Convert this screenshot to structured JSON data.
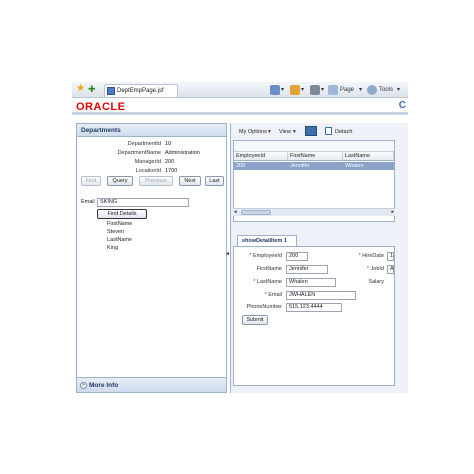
{
  "browser": {
    "tab_title": "DeptEmpPage.jsf",
    "page_menu": "Page",
    "tools_menu": "Tools"
  },
  "header": {
    "logo": "ORACLE"
  },
  "departments": {
    "title": "Departments",
    "fields": [
      {
        "label": "DepartmentId",
        "value": "10"
      },
      {
        "label": "DepartmentName",
        "value": "Administration"
      },
      {
        "label": "ManagerId",
        "value": "200"
      },
      {
        "label": "LocationId",
        "value": "1700"
      }
    ],
    "buttons": {
      "first": "First",
      "query": "Query",
      "previous": "Previous",
      "next": "Next",
      "last": "Last"
    },
    "email_label": "Email",
    "email_value": "SKING",
    "find_details": "Find Details",
    "results": [
      "FirstName",
      "Steven",
      "LastName",
      "King"
    ],
    "more_info": "More Info"
  },
  "table": {
    "options": "My Options",
    "view": "View",
    "detach": "Detach",
    "columns": [
      "EmployeeId",
      "FirstName",
      "LastName"
    ],
    "rows": [
      [
        "200",
        "Jennifer",
        "Whalen"
      ]
    ]
  },
  "detail": {
    "tab": "showDetailItem 1",
    "employee_id_label": "EmployeeId",
    "employee_id": "200",
    "hire_date_label": "HireDate",
    "hire_date": "1",
    "first_name_label": "FirstName",
    "first_name": "Jennifer",
    "job_id_label": "JobId",
    "job_id": "A",
    "last_name_label": "LastName",
    "last_name": "Whalen",
    "salary_label": "Salary",
    "email_label": "Email",
    "email": "JWHALEN",
    "phone_label": "PhoneNumber",
    "phone": "515.123.4444",
    "submit": "Submit"
  }
}
